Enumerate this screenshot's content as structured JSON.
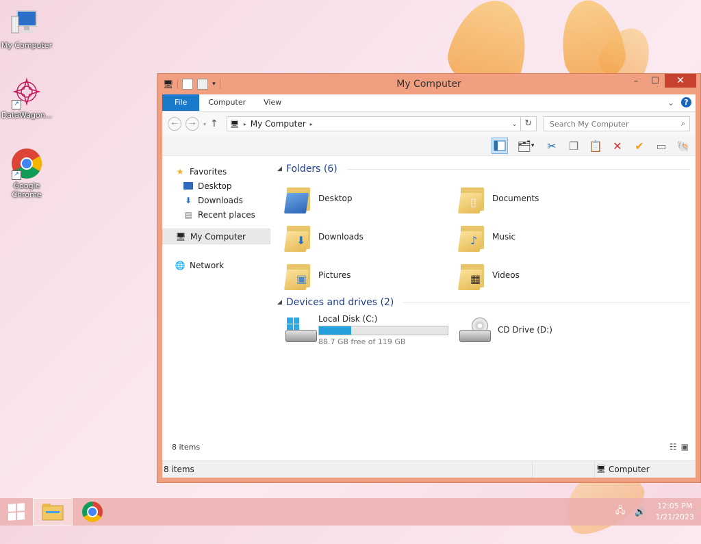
{
  "desktop": {
    "icons": [
      {
        "label": "My Computer"
      },
      {
        "label": "DataWagon..."
      },
      {
        "label": "Google Chrome"
      }
    ]
  },
  "window": {
    "title": "My Computer",
    "ribbon_tabs": [
      "File",
      "Computer",
      "View"
    ],
    "address": {
      "crumb": "My Computer"
    },
    "search": {
      "placeholder": "Search My Computer"
    },
    "nav": {
      "favorites": "Favorites",
      "desktop": "Desktop",
      "downloads": "Downloads",
      "recent": "Recent places",
      "computer": "My Computer",
      "network": "Network"
    },
    "folders_header": "Folders (6)",
    "folders": [
      {
        "name": "Desktop"
      },
      {
        "name": "Documents"
      },
      {
        "name": "Downloads"
      },
      {
        "name": "Music"
      },
      {
        "name": "Pictures"
      },
      {
        "name": "Videos"
      }
    ],
    "devices_header": "Devices and drives (2)",
    "drives": [
      {
        "name": "Local Disk (C:)",
        "free_text": "88.7 GB free of 119 GB",
        "used_fraction": 0.25
      },
      {
        "name": "CD Drive (D:)"
      }
    ],
    "item_count": "8 items",
    "status": {
      "left": "8 items",
      "right": "Computer"
    }
  },
  "taskbar": {
    "time": "12:05 PM",
    "date": "1/21/2023"
  },
  "colors": {
    "accent": "#1979ca",
    "close": "#c7432f",
    "window_frame": "#f0a080",
    "group_header": "#1e3e8f",
    "progress": "#26a0da"
  }
}
